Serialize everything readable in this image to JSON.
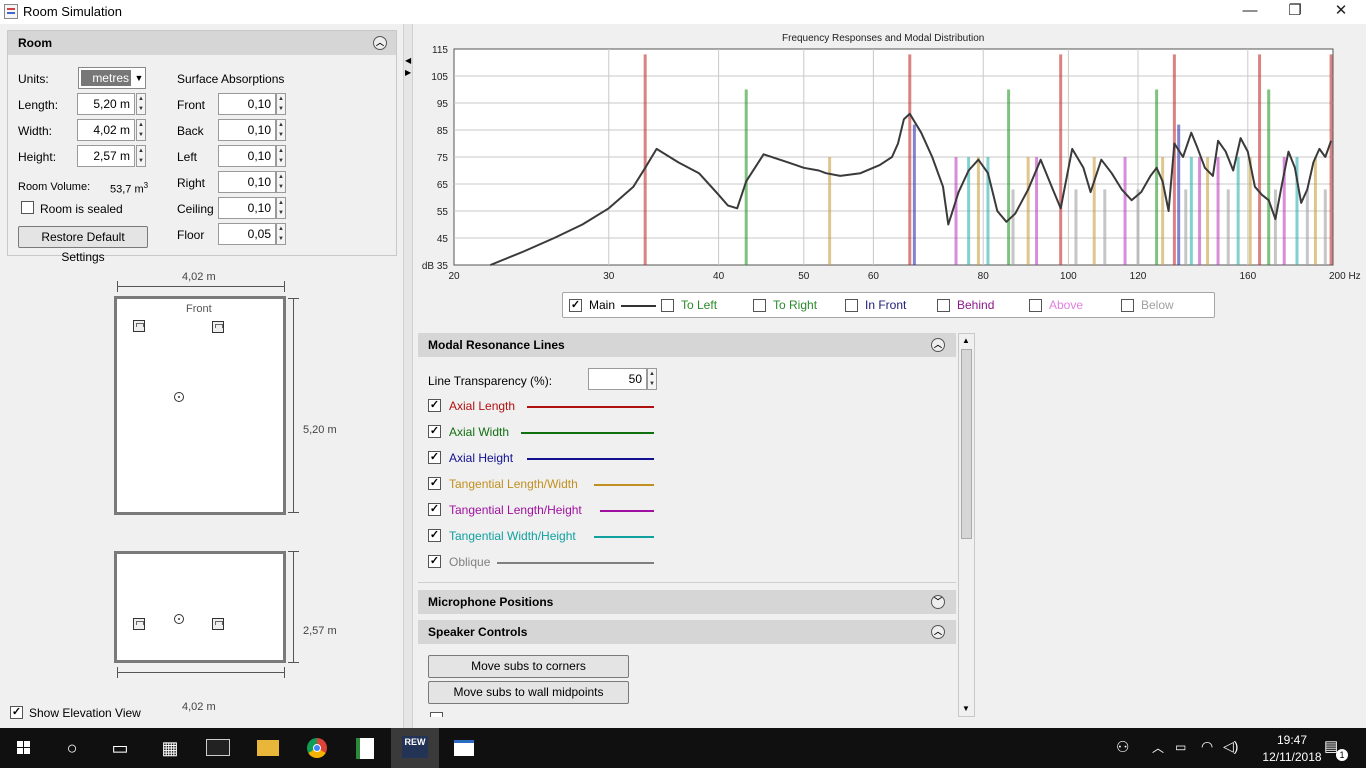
{
  "window": {
    "title": "Room Simulation",
    "minimize": "—",
    "maximize": "❐",
    "close": "✕"
  },
  "room_panel": {
    "title": "Room",
    "units_label": "Units:",
    "units_value": "metres",
    "length_label": "Length:",
    "length_value": "5,20 m",
    "width_label": "Width:",
    "width_value": "4,02 m",
    "height_label": "Height:",
    "height_value": "2,57 m",
    "volume_label": "Room Volume:",
    "volume_value": "53,7 m",
    "volume_sup": "3",
    "sealed_label": "Room is sealed",
    "restore_label": "Restore Default Settings",
    "absorption_title": "Surface Absorptions",
    "absorptions": [
      {
        "label": "Front",
        "value": "0,10"
      },
      {
        "label": "Back",
        "value": "0,10"
      },
      {
        "label": "Left",
        "value": "0,10"
      },
      {
        "label": "Right",
        "value": "0,10"
      },
      {
        "label": "Ceiling",
        "value": "0,10"
      },
      {
        "label": "Floor",
        "value": "0,05"
      }
    ]
  },
  "plan_view": {
    "top_dim": "4,02 m",
    "front_label": "Front",
    "side_dim": "5,20 m"
  },
  "elevation_view": {
    "side_dim": "2,57 m",
    "bottom_dim": "4,02 m"
  },
  "show_elevation_label": "Show Elevation View",
  "chart_data": {
    "type": "line",
    "title": "Frequency Responses and Modal Distribution",
    "x_scale": "log",
    "xlim": [
      20,
      200
    ],
    "ylim": [
      35,
      115
    ],
    "x_ticks": [
      20,
      30,
      40,
      50,
      60,
      80,
      100,
      120,
      160,
      200
    ],
    "x_tick_labels": [
      "20",
      "30",
      "40",
      "50",
      "60",
      "80",
      "100",
      "120",
      "160",
      "200 Hz"
    ],
    "y_ticks": [
      45,
      55,
      65,
      75,
      85,
      95,
      105,
      115
    ],
    "y_tick_labels": [
      "45",
      "55",
      "65",
      "75",
      "85",
      "95",
      "105",
      "115"
    ],
    "y_bottom_label": "dB 35",
    "grid": true,
    "series": [
      {
        "name": "Main",
        "color": "#3a3a3a",
        "x": [
          22,
          24,
          26,
          28,
          30,
          32,
          33,
          34,
          36,
          38,
          40,
          41,
          42,
          43,
          45,
          48,
          50,
          52,
          53,
          55,
          58,
          61,
          63,
          64,
          65,
          66,
          68,
          70,
          72,
          73,
          75,
          77,
          79,
          81,
          83,
          85,
          87,
          90,
          93,
          96,
          98,
          101,
          104,
          106,
          109,
          112,
          115,
          118,
          121,
          124,
          126,
          128,
          130,
          132,
          135,
          138,
          140,
          143,
          146,
          148,
          151,
          154,
          157,
          160,
          163,
          166,
          169,
          172,
          175,
          178,
          181,
          184,
          187,
          190,
          193,
          196,
          199
        ],
        "y": [
          35,
          40,
          45,
          50,
          56,
          64,
          71,
          78,
          73,
          69,
          61,
          57,
          56,
          66,
          76,
          73,
          71,
          70,
          69,
          68,
          69,
          72,
          75,
          80,
          89,
          91,
          84,
          75,
          64,
          50,
          62,
          70,
          74,
          69,
          55,
          51,
          54,
          63,
          74,
          63,
          56,
          78,
          71,
          62,
          74,
          69,
          63,
          59,
          62,
          68,
          71,
          66,
          55,
          80,
          75,
          84,
          79,
          71,
          68,
          81,
          77,
          70,
          82,
          77,
          64,
          61,
          59,
          52,
          65,
          77,
          71,
          58,
          63,
          73,
          78,
          75,
          81
        ]
      }
    ],
    "modal_lines": [
      {
        "f": 33,
        "type": "axial_length",
        "h": 113
      },
      {
        "f": 43,
        "type": "axial_width",
        "h": 100
      },
      {
        "f": 53.5,
        "type": "tangential_lw",
        "h": 75
      },
      {
        "f": 66,
        "type": "axial_length",
        "h": 113
      },
      {
        "f": 66.8,
        "type": "axial_height",
        "h": 87
      },
      {
        "f": 74.5,
        "type": "tangential_lh",
        "h": 75
      },
      {
        "f": 77,
        "type": "tangential_wh",
        "h": 75
      },
      {
        "f": 79,
        "type": "tangential_lw",
        "h": 75
      },
      {
        "f": 81,
        "type": "tangential_wh",
        "h": 75
      },
      {
        "f": 85.5,
        "type": "axial_width",
        "h": 100
      },
      {
        "f": 86.5,
        "type": "oblique",
        "h": 63
      },
      {
        "f": 90,
        "type": "tangential_lw",
        "h": 75
      },
      {
        "f": 92,
        "type": "tangential_lh",
        "h": 75
      },
      {
        "f": 98,
        "type": "axial_length",
        "h": 113
      },
      {
        "f": 102,
        "type": "oblique",
        "h": 63
      },
      {
        "f": 107,
        "type": "tangential_lw",
        "h": 75
      },
      {
        "f": 110,
        "type": "oblique",
        "h": 63
      },
      {
        "f": 116,
        "type": "tangential_lh",
        "h": 75
      },
      {
        "f": 120,
        "type": "oblique",
        "h": 63
      },
      {
        "f": 126,
        "type": "axial_width",
        "h": 100
      },
      {
        "f": 128,
        "type": "tangential_lw",
        "h": 75
      },
      {
        "f": 132,
        "type": "axial_length",
        "h": 113
      },
      {
        "f": 133.5,
        "type": "axial_height",
        "h": 87
      },
      {
        "f": 136,
        "type": "oblique",
        "h": 63
      },
      {
        "f": 138,
        "type": "tangential_wh",
        "h": 75
      },
      {
        "f": 141,
        "type": "tangential_lh",
        "h": 75
      },
      {
        "f": 144,
        "type": "tangential_lw",
        "h": 75
      },
      {
        "f": 148,
        "type": "tangential_lh",
        "h": 75
      },
      {
        "f": 152,
        "type": "oblique",
        "h": 63
      },
      {
        "f": 156,
        "type": "tangential_wh",
        "h": 75
      },
      {
        "f": 161,
        "type": "tangential_lw",
        "h": 75
      },
      {
        "f": 165,
        "type": "axial_length",
        "h": 113
      },
      {
        "f": 169,
        "type": "axial_width",
        "h": 100
      },
      {
        "f": 172,
        "type": "oblique",
        "h": 63
      },
      {
        "f": 176,
        "type": "tangential_lh",
        "h": 75
      },
      {
        "f": 182,
        "type": "tangential_wh",
        "h": 75
      },
      {
        "f": 187,
        "type": "oblique",
        "h": 63
      },
      {
        "f": 191,
        "type": "tangential_lw",
        "h": 75
      },
      {
        "f": 196,
        "type": "oblique",
        "h": 63
      },
      {
        "f": 199,
        "type": "axial_length",
        "h": 113
      }
    ]
  },
  "line_colors": {
    "axial_length": "#c03030",
    "axial_width": "#2a9a2a",
    "axial_height": "#3030b0",
    "tangential_lw": "#c9a040",
    "tangential_lh": "#c040c0",
    "tangential_wh": "#30b0b0",
    "oblique": "#a0a0a0"
  },
  "legend": [
    {
      "label": "Main",
      "checked": true,
      "color": "#000000"
    },
    {
      "label": "To Left",
      "checked": false,
      "color": "#2a8a2a"
    },
    {
      "label": "To Right",
      "checked": false,
      "color": "#2a8a2a"
    },
    {
      "label": "In Front",
      "checked": false,
      "color": "#20207a"
    },
    {
      "label": "Behind",
      "checked": false,
      "color": "#8a1a8a"
    },
    {
      "label": "Above",
      "checked": false,
      "color": "#e080e0"
    },
    {
      "label": "Below",
      "checked": false,
      "color": "#a0a0a0"
    }
  ],
  "modal_panel": {
    "title": "Modal Resonance Lines",
    "transparency_label": "Line Transparency (%):",
    "transparency_value": "50",
    "lines": [
      {
        "label": "Axial Length",
        "color": "#b01010",
        "checked": true
      },
      {
        "label": "Axial Width",
        "color": "#107010",
        "checked": true
      },
      {
        "label": "Axial Height",
        "color": "#101090",
        "checked": true
      },
      {
        "label": "Tangential Length/Width",
        "color": "#c09020",
        "checked": true
      },
      {
        "label": "Tangential Length/Height",
        "color": "#a010a0",
        "checked": true
      },
      {
        "label": "Tangential Width/Height",
        "color": "#10a0a0",
        "checked": true
      },
      {
        "label": "Oblique",
        "color": "#808080",
        "checked": true
      }
    ]
  },
  "mic_panel": {
    "title": "Microphone Positions"
  },
  "speaker_panel": {
    "title": "Speaker Controls",
    "corners_btn": "Move subs to corners",
    "midpoints_btn": "Move subs to wall midpoints"
  },
  "taskbar": {
    "time": "19:47",
    "date": "12/11/2018",
    "notif": "1"
  }
}
